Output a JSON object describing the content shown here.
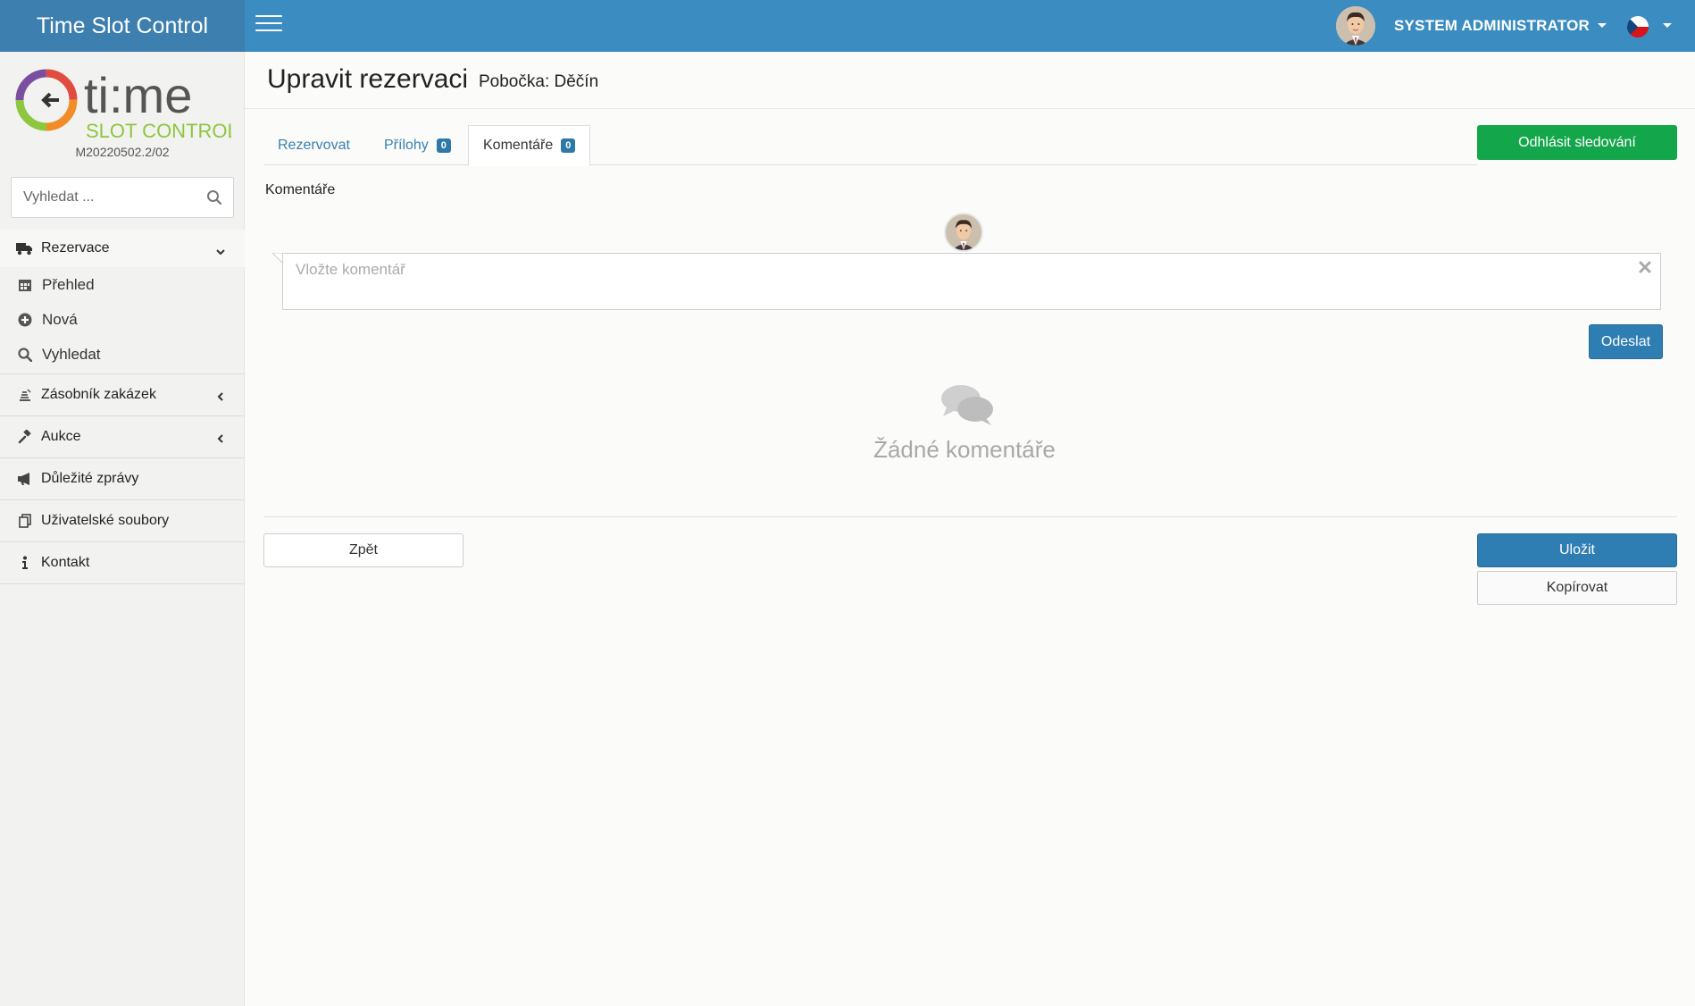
{
  "app": {
    "title": "Time Slot Control",
    "version": "M20220502.2/02",
    "logo_text_main": "ti:me",
    "logo_text_sub": "SLOT CONTROL"
  },
  "header": {
    "user_name": "SYSTEM ADMINISTRATOR",
    "language_flag": "czech-flag-icon"
  },
  "sidebar": {
    "search_placeholder": "Vyhledat ...",
    "items": [
      {
        "label": "Rezervace",
        "icon": "truck-icon",
        "expanded": true,
        "children": [
          {
            "label": "Přehled",
            "icon": "calendar-icon"
          },
          {
            "label": "Nová",
            "icon": "plus-circle-icon"
          },
          {
            "label": "Vyhledat",
            "icon": "search-icon"
          }
        ]
      },
      {
        "label": "Zásobník zakázek",
        "icon": "stack-icon",
        "expanded": false
      },
      {
        "label": "Aukce",
        "icon": "gavel-icon",
        "expanded": false
      },
      {
        "label": "Důležité zprávy",
        "icon": "megaphone-icon"
      },
      {
        "label": "Uživatelské soubory",
        "icon": "files-icon"
      },
      {
        "label": "Kontakt",
        "icon": "info-icon"
      }
    ]
  },
  "page": {
    "title": "Upravit rezervaci",
    "subtitle": "Pobočka: Děčín"
  },
  "tabs": [
    {
      "label": "Rezervovat",
      "badge": null
    },
    {
      "label": "Přílohy",
      "badge": "0"
    },
    {
      "label": "Komentáře",
      "badge": "0",
      "active": true
    }
  ],
  "actions": {
    "unfollow_label": "Odhlásit sledování",
    "send_label": "Odeslat",
    "back_label": "Zpět",
    "save_label": "Uložit",
    "copy_label": "Kopírovat"
  },
  "comments": {
    "section_label": "Komentáře",
    "input_placeholder": "Vložte komentář",
    "empty_text": "Žádné komentáře"
  },
  "colors": {
    "header": "#3a8cc1",
    "brand": "#3d7fae",
    "primary": "#2f7eb3",
    "success": "#13a64b"
  }
}
